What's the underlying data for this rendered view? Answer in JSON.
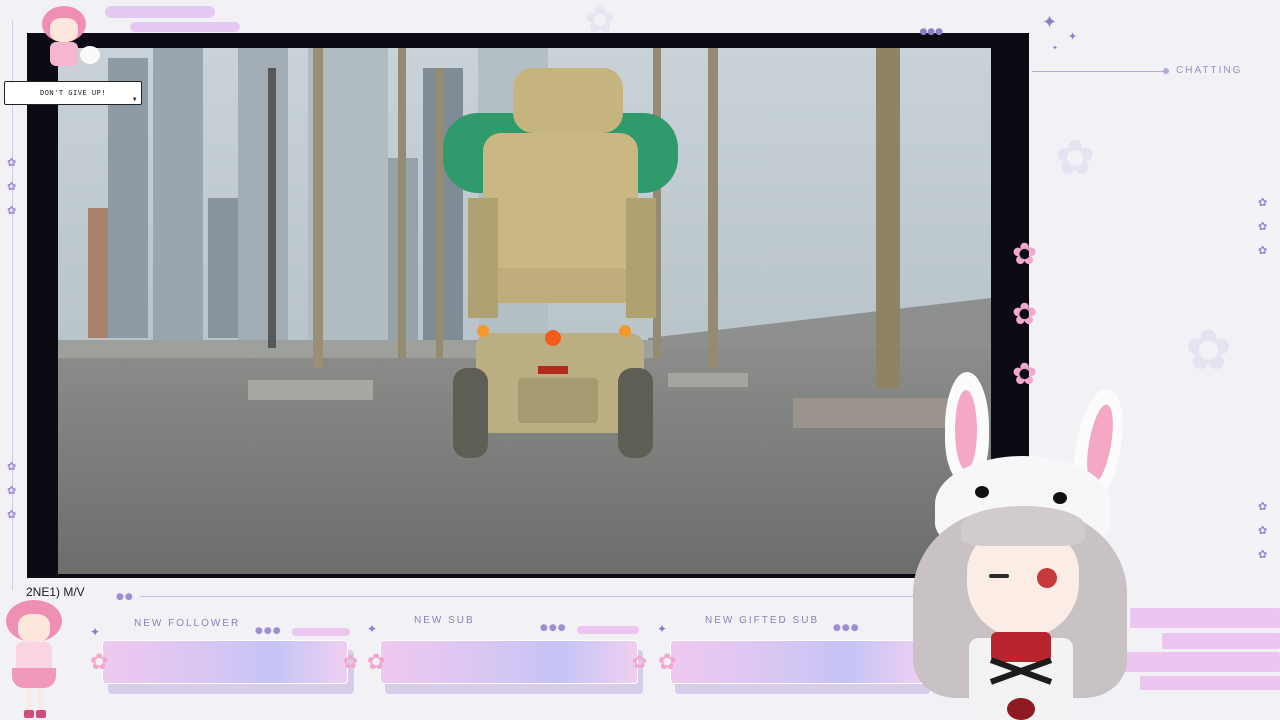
{
  "overlay": {
    "speech_bubble": "DON'T GIVE UP!",
    "chat_label": "CHATTING",
    "video_title": "2NE1) M/V"
  },
  "alerts": [
    {
      "label": "NEW FOLLOWER"
    },
    {
      "label": "NEW SUB"
    },
    {
      "label": "NEW GIFTED SUB"
    }
  ],
  "colors": {
    "frame": "#0c0a12",
    "accent_lavender": "#9d8ec7",
    "accent_pink": "#f3a7cf",
    "background": "#f2f1f5"
  },
  "icons": [
    "sakura-icon",
    "violet-flower-icon",
    "sparkle-icon",
    "scroll-arrow-icon"
  ]
}
